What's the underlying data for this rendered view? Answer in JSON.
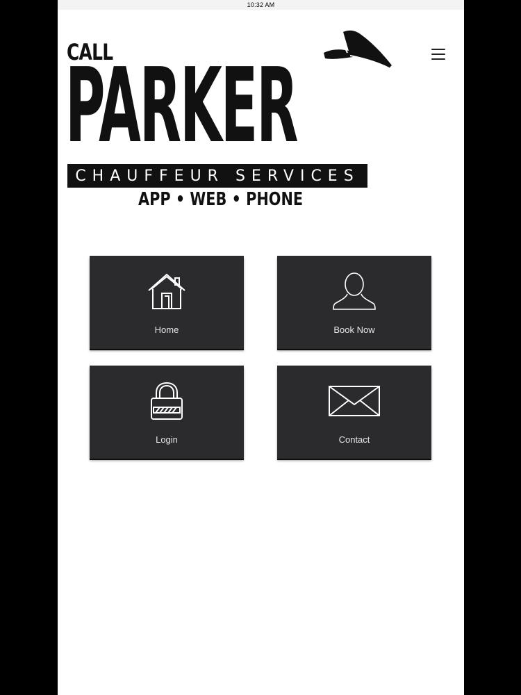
{
  "statusbar": {
    "time": "10:32 AM"
  },
  "logo": {
    "call": "CALL",
    "wordmark": "PARKER",
    "band": "CHAUFFEUR SERVICES",
    "tagline": "APP • WEB • PHONE"
  },
  "menu": {
    "icon": "hamburger-menu-icon"
  },
  "tiles": [
    {
      "label": "Home",
      "icon": "house-icon"
    },
    {
      "label": "Book Now",
      "icon": "person-icon"
    },
    {
      "label": "Login",
      "icon": "padlock-icon"
    },
    {
      "label": "Contact",
      "icon": "envelope-icon"
    }
  ],
  "colors": {
    "tile_bg": "#2b2a2d",
    "tile_text": "#e6e6e6",
    "logo": "#111111",
    "page_bg": "#ffffff"
  }
}
